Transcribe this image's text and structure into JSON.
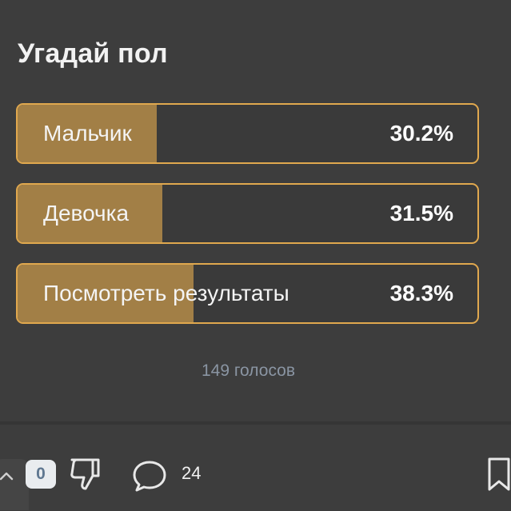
{
  "poll": {
    "title": "Угадай пол",
    "options": [
      {
        "label": "Мальчик",
        "percent_text": "30.2%",
        "percent": 30.2
      },
      {
        "label": "Девочка",
        "percent_text": "31.5%",
        "percent": 31.5
      },
      {
        "label": "Посмотреть результаты",
        "percent_text": "38.3%",
        "percent": 38.3
      }
    ],
    "votes_text": "149 голосов"
  },
  "footer": {
    "score": "0",
    "comments_count": "24"
  },
  "colors": {
    "background": "#3d3d3d",
    "accent_border": "#e0a84e",
    "fill": "#a27f46",
    "votes_text": "#8a95a3"
  }
}
